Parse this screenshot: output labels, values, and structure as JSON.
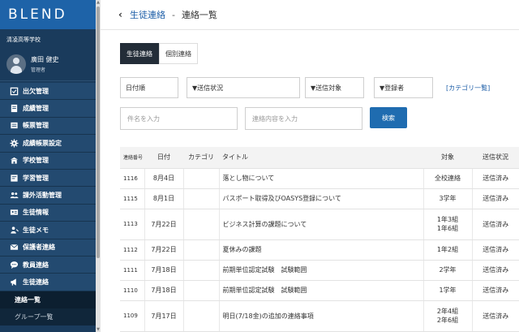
{
  "brand": "BLEND",
  "school": "清凌高等学校",
  "user": {
    "name": "廣田 健史",
    "role": "管理者"
  },
  "menu": [
    {
      "label": "出欠管理",
      "icon": "attendance-icon"
    },
    {
      "label": "成績管理",
      "icon": "grades-icon"
    },
    {
      "label": "帳票管理",
      "icon": "documents-icon"
    },
    {
      "label": "成績帳票設定",
      "icon": "gear-icon"
    },
    {
      "label": "学校管理",
      "icon": "school-icon"
    },
    {
      "label": "学習管理",
      "icon": "study-icon"
    },
    {
      "label": "課外活動管理",
      "icon": "group-icon"
    },
    {
      "label": "生徒情報",
      "icon": "id-card-icon"
    },
    {
      "label": "生徒メモ",
      "icon": "memo-icon"
    },
    {
      "label": "保護者連絡",
      "icon": "envelope-icon"
    },
    {
      "label": "教員連絡",
      "icon": "chat-icon"
    },
    {
      "label": "生徒連絡",
      "icon": "megaphone-icon"
    }
  ],
  "submenu": [
    {
      "label": "連絡一覧"
    },
    {
      "label": "グループ一覧"
    }
  ],
  "breadcrumb": {
    "back": "‹",
    "parent": "生徒連絡",
    "separator": "-",
    "current": "連絡一覧"
  },
  "tabs": [
    {
      "label": "生徒連絡"
    },
    {
      "label": "個別連絡"
    }
  ],
  "filters": {
    "sort": "日付順",
    "status": "▼送信状況",
    "target": "▼送信対象",
    "registrant": "▼登録者",
    "category_link": "[カテゴリ一覧]"
  },
  "search": {
    "subject_placeholder": "件名を入力",
    "content_placeholder": "連絡内容を入力",
    "button": "検索"
  },
  "table": {
    "headers": {
      "number": "連絡番号",
      "date": "日付",
      "category": "カテゴリ",
      "title": "タイトル",
      "target": "対象",
      "status": "送信状況"
    },
    "rows": [
      {
        "number": "1116",
        "date": "8月4日",
        "category": "",
        "title": "落とし物について",
        "target": "全校連絡",
        "target2": "",
        "status": "送信済み"
      },
      {
        "number": "1115",
        "date": "8月1日",
        "category": "",
        "title": "パスポート取得及びOASYS登録について",
        "target": "3学年",
        "target2": "",
        "status": "送信済み"
      },
      {
        "number": "1113",
        "date": "7月22日",
        "category": "",
        "title": "ビジネス計算の課題について",
        "target": "1年3組",
        "target2": "1年6組",
        "status": "送信済み"
      },
      {
        "number": "1112",
        "date": "7月22日",
        "category": "",
        "title": "夏休みの課題",
        "target": "1年2組",
        "target2": "",
        "status": "送信済み"
      },
      {
        "number": "1111",
        "date": "7月18日",
        "category": "",
        "title": "前期単位認定試験　試験範囲",
        "target": "2学年",
        "target2": "",
        "status": "送信済み"
      },
      {
        "number": "1110",
        "date": "7月18日",
        "category": "",
        "title": "前期単位認定試験　試験範囲",
        "target": "1学年",
        "target2": "",
        "status": "送信済み"
      },
      {
        "number": "1109",
        "date": "7月17日",
        "category": "",
        "title": "明日(7/18金)の追加の連絡事項",
        "target": "2年4組",
        "target2": "2年6組",
        "status": "送信済み"
      }
    ]
  },
  "colors": {
    "sidebar": "#1a3b5c",
    "brand_bar": "#1e63a8",
    "accent": "#1f6cb0",
    "active_tab": "#232d38"
  }
}
